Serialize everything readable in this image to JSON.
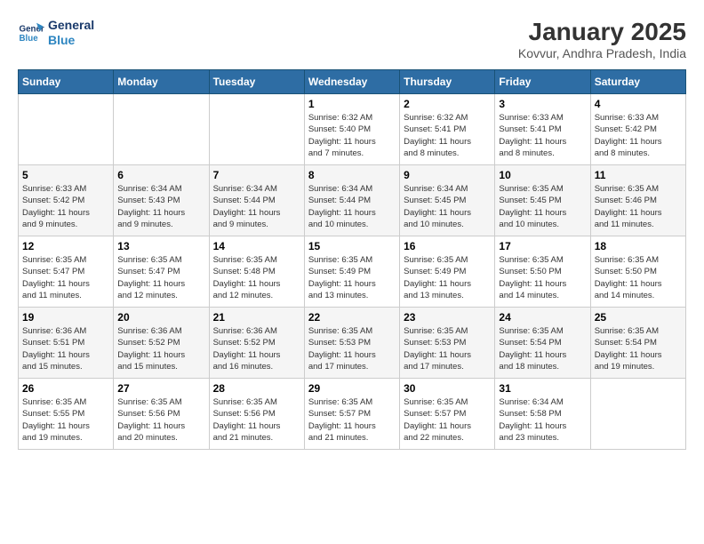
{
  "logo": {
    "line1": "General",
    "line2": "Blue"
  },
  "title": "January 2025",
  "subtitle": "Kovvur, Andhra Pradesh, India",
  "weekdays": [
    "Sunday",
    "Monday",
    "Tuesday",
    "Wednesday",
    "Thursday",
    "Friday",
    "Saturday"
  ],
  "weeks": [
    [
      {
        "day": "",
        "info": ""
      },
      {
        "day": "",
        "info": ""
      },
      {
        "day": "",
        "info": ""
      },
      {
        "day": "1",
        "info": "Sunrise: 6:32 AM\nSunset: 5:40 PM\nDaylight: 11 hours\nand 7 minutes."
      },
      {
        "day": "2",
        "info": "Sunrise: 6:32 AM\nSunset: 5:41 PM\nDaylight: 11 hours\nand 8 minutes."
      },
      {
        "day": "3",
        "info": "Sunrise: 6:33 AM\nSunset: 5:41 PM\nDaylight: 11 hours\nand 8 minutes."
      },
      {
        "day": "4",
        "info": "Sunrise: 6:33 AM\nSunset: 5:42 PM\nDaylight: 11 hours\nand 8 minutes."
      }
    ],
    [
      {
        "day": "5",
        "info": "Sunrise: 6:33 AM\nSunset: 5:42 PM\nDaylight: 11 hours\nand 9 minutes."
      },
      {
        "day": "6",
        "info": "Sunrise: 6:34 AM\nSunset: 5:43 PM\nDaylight: 11 hours\nand 9 minutes."
      },
      {
        "day": "7",
        "info": "Sunrise: 6:34 AM\nSunset: 5:44 PM\nDaylight: 11 hours\nand 9 minutes."
      },
      {
        "day": "8",
        "info": "Sunrise: 6:34 AM\nSunset: 5:44 PM\nDaylight: 11 hours\nand 10 minutes."
      },
      {
        "day": "9",
        "info": "Sunrise: 6:34 AM\nSunset: 5:45 PM\nDaylight: 11 hours\nand 10 minutes."
      },
      {
        "day": "10",
        "info": "Sunrise: 6:35 AM\nSunset: 5:45 PM\nDaylight: 11 hours\nand 10 minutes."
      },
      {
        "day": "11",
        "info": "Sunrise: 6:35 AM\nSunset: 5:46 PM\nDaylight: 11 hours\nand 11 minutes."
      }
    ],
    [
      {
        "day": "12",
        "info": "Sunrise: 6:35 AM\nSunset: 5:47 PM\nDaylight: 11 hours\nand 11 minutes."
      },
      {
        "day": "13",
        "info": "Sunrise: 6:35 AM\nSunset: 5:47 PM\nDaylight: 11 hours\nand 12 minutes."
      },
      {
        "day": "14",
        "info": "Sunrise: 6:35 AM\nSunset: 5:48 PM\nDaylight: 11 hours\nand 12 minutes."
      },
      {
        "day": "15",
        "info": "Sunrise: 6:35 AM\nSunset: 5:49 PM\nDaylight: 11 hours\nand 13 minutes."
      },
      {
        "day": "16",
        "info": "Sunrise: 6:35 AM\nSunset: 5:49 PM\nDaylight: 11 hours\nand 13 minutes."
      },
      {
        "day": "17",
        "info": "Sunrise: 6:35 AM\nSunset: 5:50 PM\nDaylight: 11 hours\nand 14 minutes."
      },
      {
        "day": "18",
        "info": "Sunrise: 6:35 AM\nSunset: 5:50 PM\nDaylight: 11 hours\nand 14 minutes."
      }
    ],
    [
      {
        "day": "19",
        "info": "Sunrise: 6:36 AM\nSunset: 5:51 PM\nDaylight: 11 hours\nand 15 minutes."
      },
      {
        "day": "20",
        "info": "Sunrise: 6:36 AM\nSunset: 5:52 PM\nDaylight: 11 hours\nand 15 minutes."
      },
      {
        "day": "21",
        "info": "Sunrise: 6:36 AM\nSunset: 5:52 PM\nDaylight: 11 hours\nand 16 minutes."
      },
      {
        "day": "22",
        "info": "Sunrise: 6:35 AM\nSunset: 5:53 PM\nDaylight: 11 hours\nand 17 minutes."
      },
      {
        "day": "23",
        "info": "Sunrise: 6:35 AM\nSunset: 5:53 PM\nDaylight: 11 hours\nand 17 minutes."
      },
      {
        "day": "24",
        "info": "Sunrise: 6:35 AM\nSunset: 5:54 PM\nDaylight: 11 hours\nand 18 minutes."
      },
      {
        "day": "25",
        "info": "Sunrise: 6:35 AM\nSunset: 5:54 PM\nDaylight: 11 hours\nand 19 minutes."
      }
    ],
    [
      {
        "day": "26",
        "info": "Sunrise: 6:35 AM\nSunset: 5:55 PM\nDaylight: 11 hours\nand 19 minutes."
      },
      {
        "day": "27",
        "info": "Sunrise: 6:35 AM\nSunset: 5:56 PM\nDaylight: 11 hours\nand 20 minutes."
      },
      {
        "day": "28",
        "info": "Sunrise: 6:35 AM\nSunset: 5:56 PM\nDaylight: 11 hours\nand 21 minutes."
      },
      {
        "day": "29",
        "info": "Sunrise: 6:35 AM\nSunset: 5:57 PM\nDaylight: 11 hours\nand 21 minutes."
      },
      {
        "day": "30",
        "info": "Sunrise: 6:35 AM\nSunset: 5:57 PM\nDaylight: 11 hours\nand 22 minutes."
      },
      {
        "day": "31",
        "info": "Sunrise: 6:34 AM\nSunset: 5:58 PM\nDaylight: 11 hours\nand 23 minutes."
      },
      {
        "day": "",
        "info": ""
      }
    ]
  ]
}
